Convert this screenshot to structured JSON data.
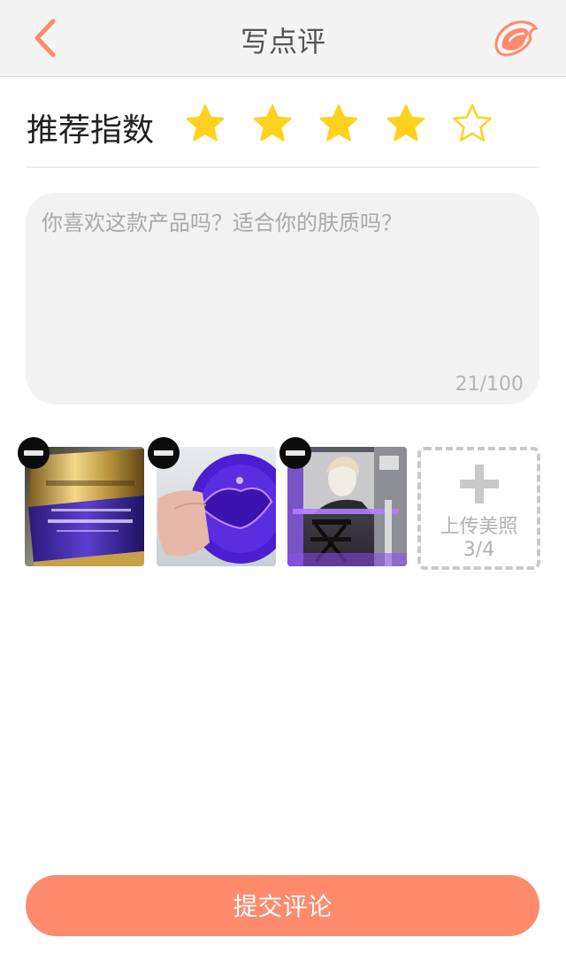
{
  "navbar": {
    "title": "写点评",
    "back_icon": "chevron-left-icon",
    "logo_icon": "brand-logo-icon",
    "accent_color": "#ff8a6c"
  },
  "rating": {
    "label": "推荐指数",
    "value": 4,
    "max": 5,
    "filled_color": "#ffd21f",
    "empty_color": "#ffd21f"
  },
  "review": {
    "placeholder": "你喜欢这款产品吗？适合你的肤质吗？",
    "value": "",
    "counter": "21/100"
  },
  "photos": {
    "items": [
      {
        "name": "lancome-renergie-jar-photo",
        "remove_icon": "remove-icon"
      },
      {
        "name": "purple-cushion-compact-photo",
        "remove_icon": "remove-icon"
      },
      {
        "name": "photo-studio-portrait-photo",
        "remove_icon": "remove-icon"
      }
    ],
    "upload_label": "上传美照",
    "upload_count": "3/4",
    "upload_icon": "plus-icon"
  },
  "submit": {
    "label": "提交评论",
    "color": "#ff8a6c"
  }
}
